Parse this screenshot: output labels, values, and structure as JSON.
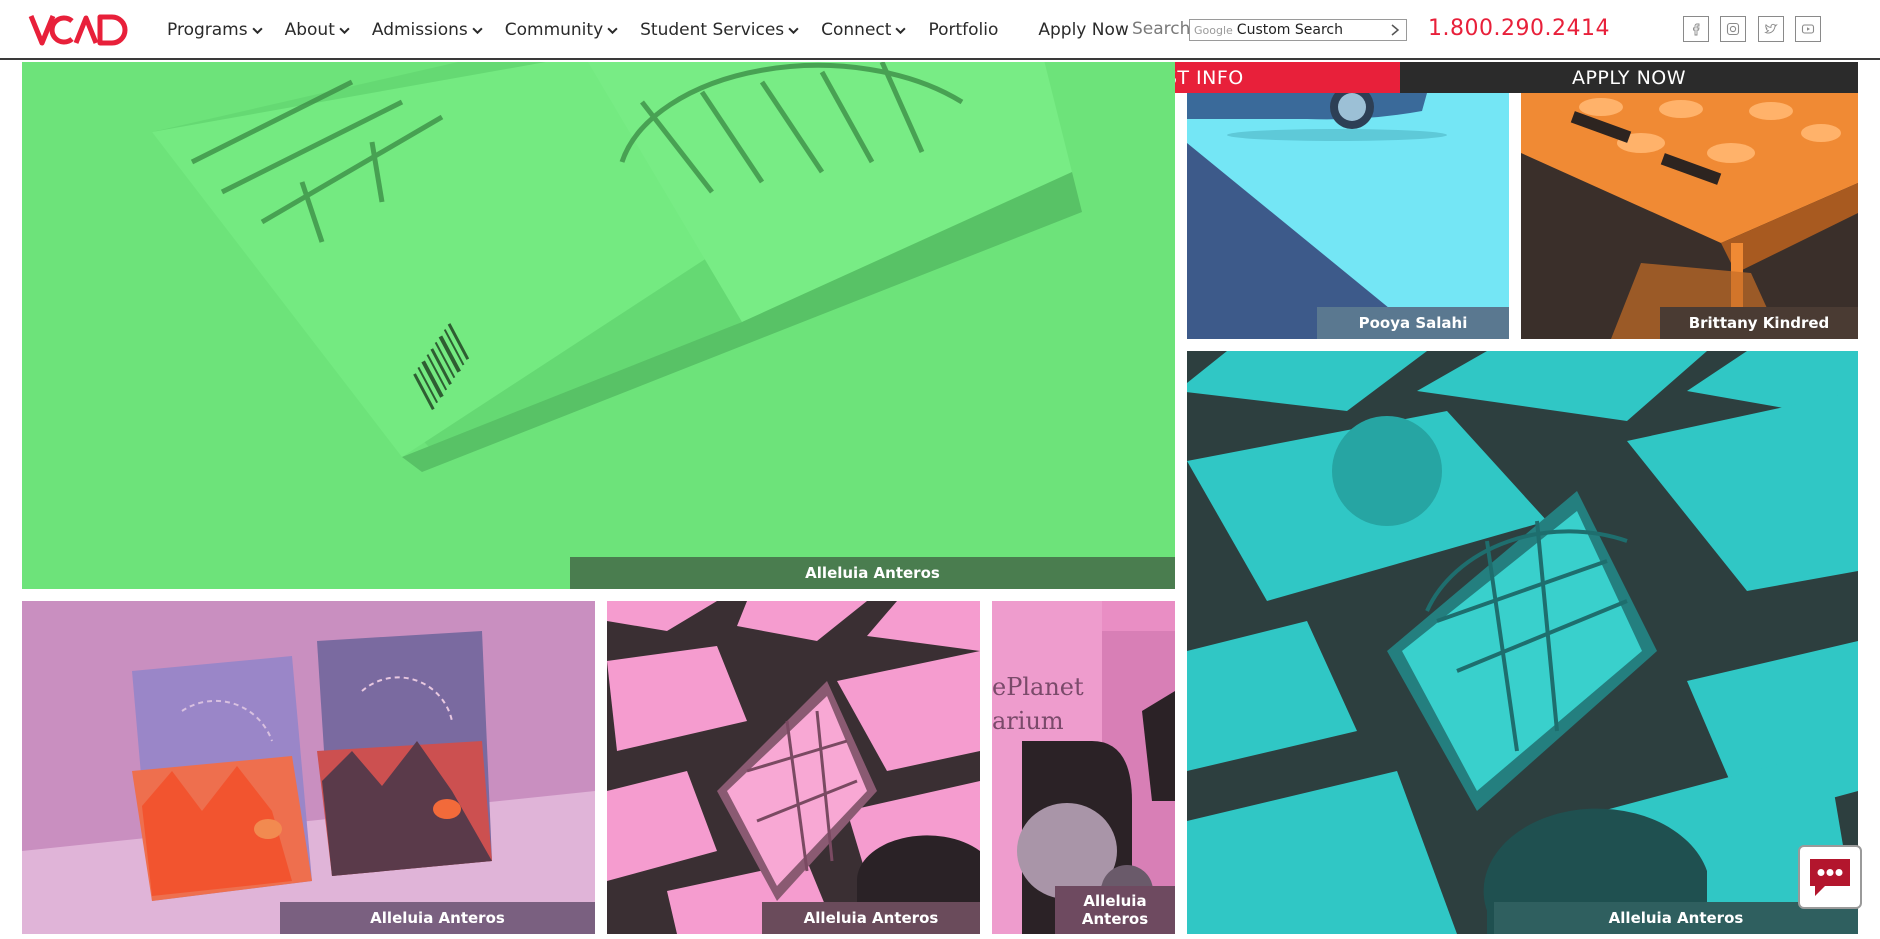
{
  "brand": {
    "logo_text": "VCAD",
    "accent": "#e8203a"
  },
  "nav": {
    "items": [
      {
        "label": "Programs",
        "dropdown": true
      },
      {
        "label": "About",
        "dropdown": true
      },
      {
        "label": "Admissions",
        "dropdown": true
      },
      {
        "label": "Community",
        "dropdown": true
      },
      {
        "label": "Student Services",
        "dropdown": true
      },
      {
        "label": "Connect",
        "dropdown": true
      },
      {
        "label": "Portfolio",
        "dropdown": false
      },
      {
        "label": "Apply Now",
        "dropdown": false
      }
    ]
  },
  "search": {
    "label": "Search",
    "provider": "Google",
    "value": "Custom Search",
    "icon": "chevron-right-icon"
  },
  "phone": "1.800.290.2414",
  "social": [
    {
      "name": "facebook",
      "icon": "facebook-icon",
      "glyph": "f"
    },
    {
      "name": "instagram",
      "icon": "instagram-icon",
      "glyph": "◎"
    },
    {
      "name": "twitter",
      "icon": "twitter-icon",
      "glyph": "t"
    },
    {
      "name": "youtube",
      "icon": "youtube-icon",
      "glyph": "▶"
    }
  ],
  "cta": {
    "request_info": "REQUEST INFO",
    "apply_now": "APPLY NOW"
  },
  "gallery": {
    "tiles": [
      {
        "id": "book-green",
        "caption": "Alleluia Anteros",
        "color": "#6de37a"
      },
      {
        "id": "car-blue",
        "caption": "Pooya Salahi",
        "color": "#74e6f5"
      },
      {
        "id": "table-orange",
        "caption": "Brittany Kindred",
        "color": "#f08a34"
      },
      {
        "id": "tablet-teal",
        "caption": "Alleluia Anteros",
        "color": "#2fbfbf"
      },
      {
        "id": "cards-purple",
        "caption": "Alleluia Anteros",
        "color": "#c98fc0"
      },
      {
        "id": "tablet-pink",
        "caption": "Alleluia Anteros",
        "color": "#f39ad0"
      },
      {
        "id": "magazine-pink",
        "caption": "Alleluia Anteros",
        "color": "#e98ec4"
      }
    ],
    "magazine_text": [
      "ePlanet",
      "arium"
    ]
  },
  "chat": {
    "icon": "chat-bubble-icon"
  }
}
